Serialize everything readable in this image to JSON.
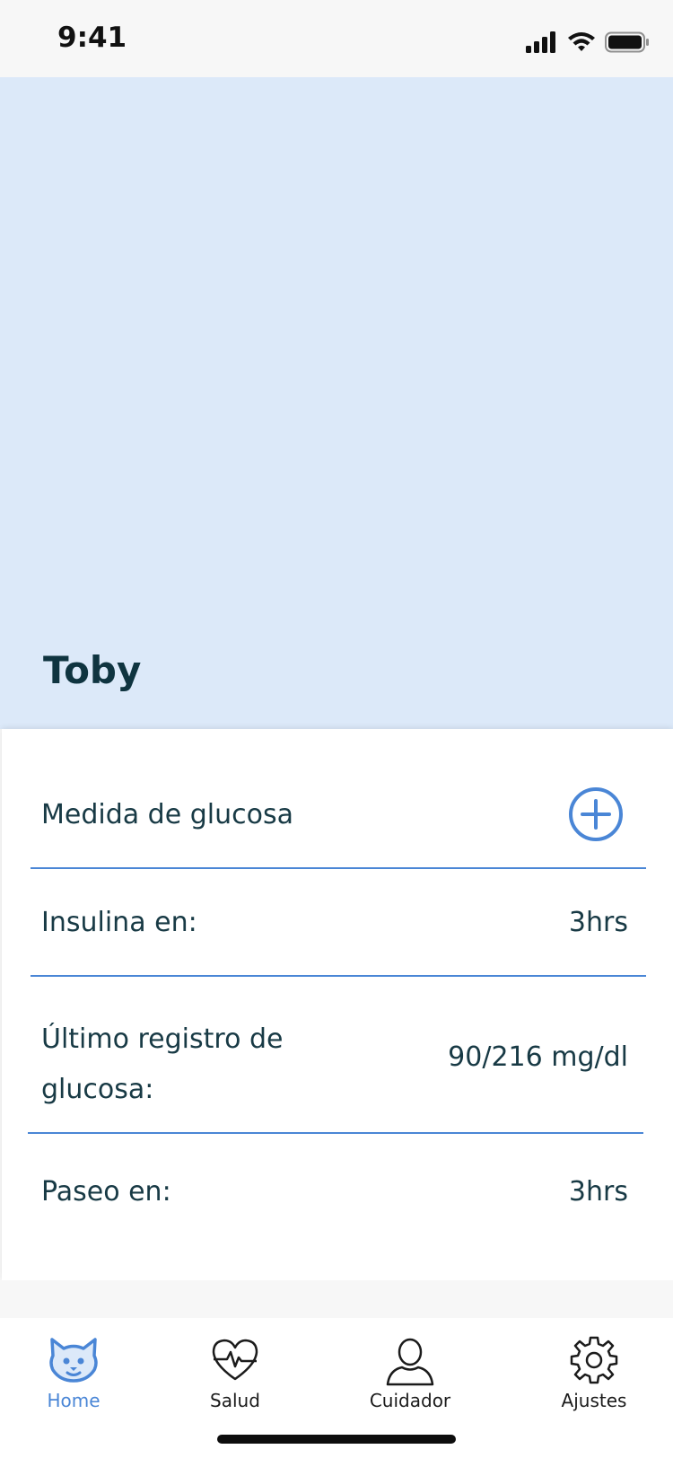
{
  "status": {
    "time": "9:41"
  },
  "pet": {
    "name": "Toby"
  },
  "rows": [
    {
      "label": "Medida de glucosa",
      "value": ""
    },
    {
      "label": "Insulina en:",
      "value": "3hrs"
    },
    {
      "label": "Último registro de glucosa:",
      "value": "90/216 mg/dl"
    },
    {
      "label": "Paseo en:",
      "value": "3hrs"
    }
  ],
  "tabs": [
    {
      "label": "Home",
      "icon": "cat-icon",
      "active": true
    },
    {
      "label": "Salud",
      "icon": "heart-pulse-icon",
      "active": false
    },
    {
      "label": "Cuidador",
      "icon": "person-icon",
      "active": false
    },
    {
      "label": "Ajustes",
      "icon": "gear-icon",
      "active": false
    }
  ],
  "colors": {
    "accent": "#4a86d6",
    "hero_bg": "#dce9f9",
    "text": "#183a45"
  }
}
